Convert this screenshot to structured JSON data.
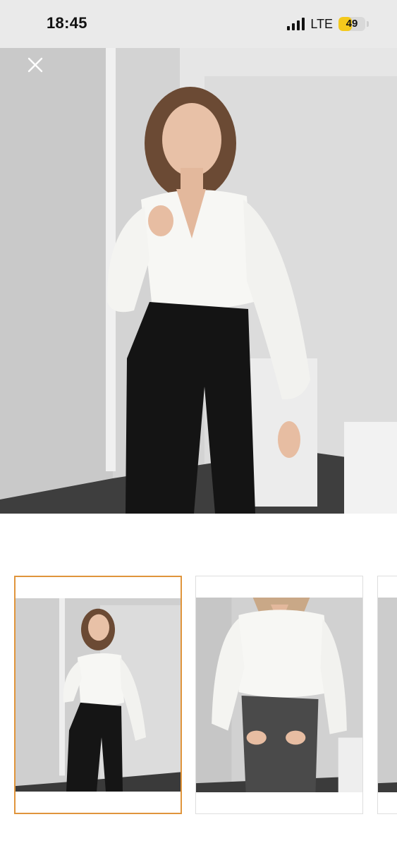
{
  "status_bar": {
    "time": "18:45",
    "network": "LTE",
    "battery_level": "49",
    "battery_fraction": 0.49,
    "battery_color": "#f4c91c",
    "signal_bars": 4
  },
  "viewer": {
    "close_icon": "close-icon",
    "main_image_alt": "product-photo-main",
    "selected_thumbnail_index": 0,
    "selected_border_color": "#e0953c"
  },
  "thumbnails": [
    {
      "name": "thumbnail-1",
      "selected": true
    },
    {
      "name": "thumbnail-2",
      "selected": false
    },
    {
      "name": "thumbnail-3",
      "selected": false
    }
  ]
}
